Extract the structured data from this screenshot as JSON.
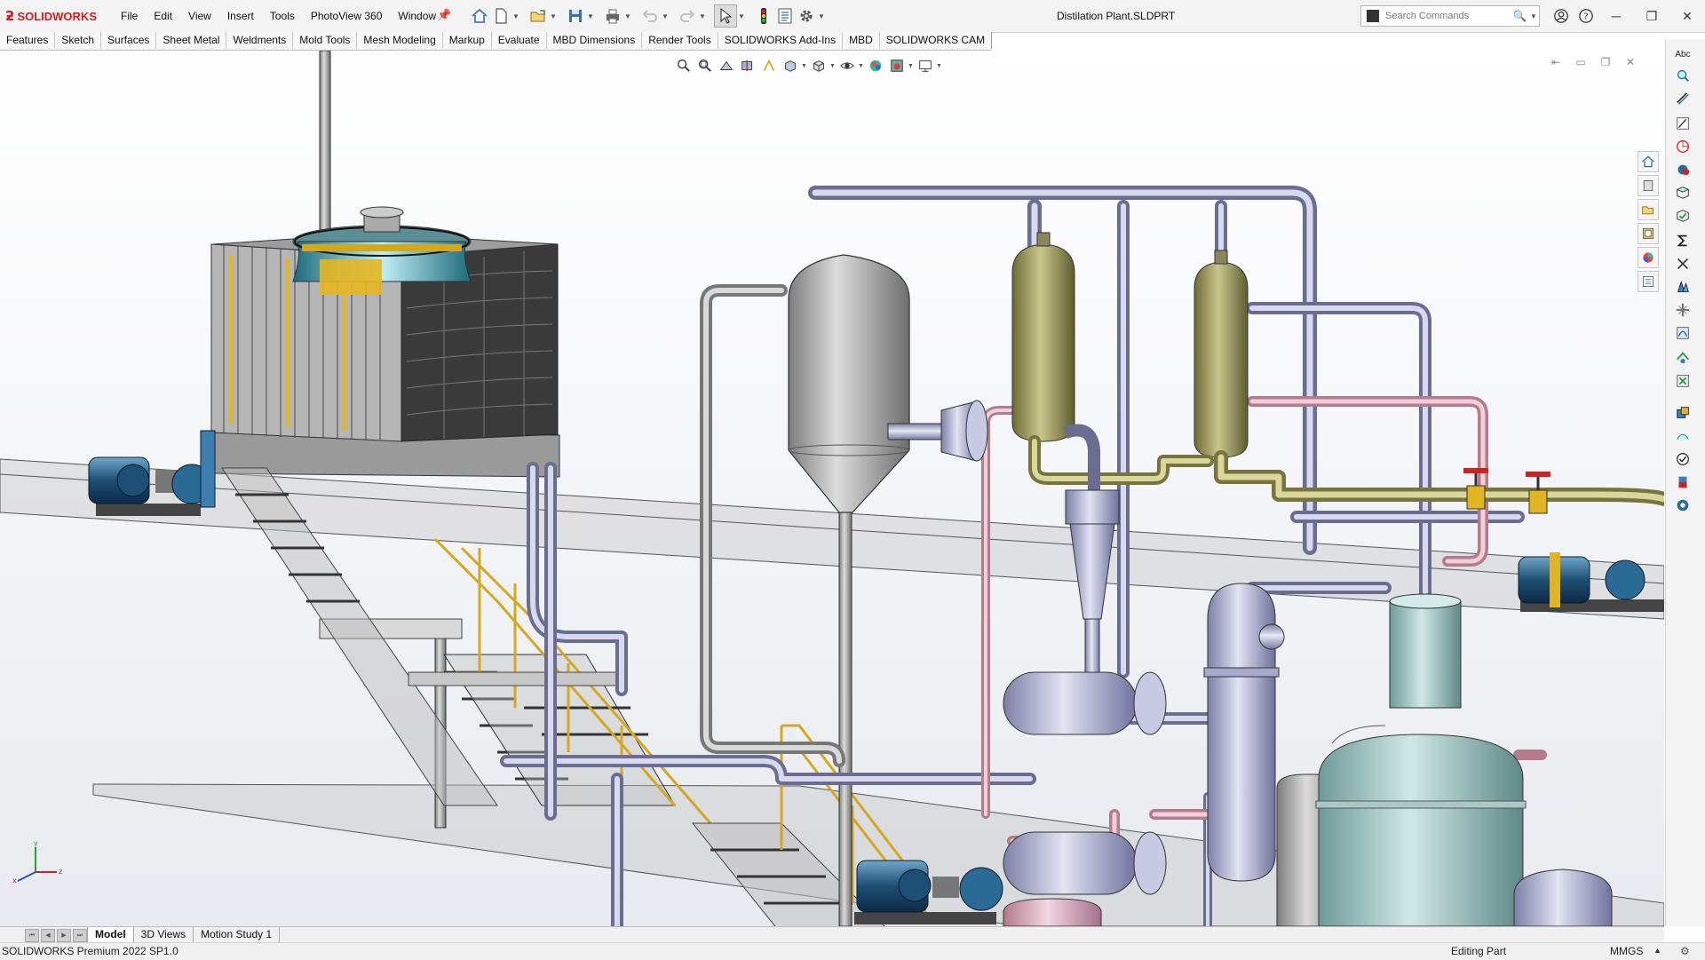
{
  "app": {
    "brand": "SOLIDWORKS",
    "document_title": "Distilation Plant.SLDPRT",
    "accent_color": "#d71920"
  },
  "menu": [
    "File",
    "Edit",
    "View",
    "Insert",
    "Tools",
    "PhotoView 360",
    "Window"
  ],
  "search": {
    "placeholder": "Search Commands"
  },
  "command_tabs": [
    "Features",
    "Sketch",
    "Surfaces",
    "Sheet Metal",
    "Weldments",
    "Mold Tools",
    "Mesh Modeling",
    "Markup",
    "Evaluate",
    "MBD Dimensions",
    "Render Tools",
    "SOLIDWORKS Add-Ins",
    "MBD",
    "SOLIDWORKS CAM"
  ],
  "right_toolbar": {
    "top_label": "Abc"
  },
  "bottom_tabs": [
    "Model",
    "3D Views",
    "Motion Study 1"
  ],
  "status": {
    "product": "SOLIDWORKS Premium 2022 SP1.0",
    "mode": "Editing Part",
    "units": "MMGS"
  },
  "triad": {
    "x": "x",
    "y": "y",
    "z": "z"
  }
}
